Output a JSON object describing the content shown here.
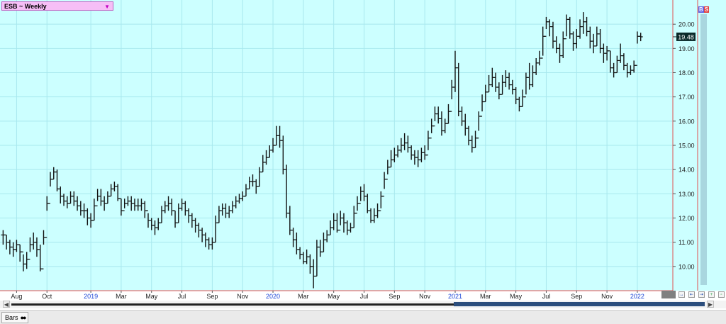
{
  "header": {
    "symbol_label": "ESB ~ Weekly",
    "dropdown_icon": "triangle-down-icon",
    "badge_b": "B",
    "badge_s": "S"
  },
  "colors": {
    "plot_bg": "#ccffff",
    "grid": "#a8e8ee",
    "bars": "#111111",
    "axis_line": "#e05050",
    "date_year": "#1a45d6",
    "price_tag_bg": "#0a2a2a"
  },
  "footer": {
    "tab_label": "Bars",
    "scroll_left_icon": "arrow-left-icon",
    "scroll_right_icon": "arrow-right-icon"
  },
  "chart_data": {
    "type": "bar",
    "subtype": "ohlc",
    "series_name": "ESB",
    "interval": "Weekly",
    "last_price_label": "19.48",
    "ylim": [
      9.0,
      21.0
    ],
    "y_ticks": [
      "10.00",
      "11.00",
      "12.00",
      "13.00",
      "14.00",
      "15.00",
      "16.00",
      "17.00",
      "18.00",
      "19.00",
      "20.00"
    ],
    "x_ticks": [
      {
        "label": "Aug",
        "t": 4,
        "year": false
      },
      {
        "label": "Oct",
        "t": 13,
        "year": false
      },
      {
        "label": "2019",
        "t": 26,
        "year": true
      },
      {
        "label": "Mar",
        "t": 35,
        "year": false
      },
      {
        "label": "May",
        "t": 44,
        "year": false
      },
      {
        "label": "Jul",
        "t": 53,
        "year": false
      },
      {
        "label": "Sep",
        "t": 62,
        "year": false
      },
      {
        "label": "Nov",
        "t": 71,
        "year": false
      },
      {
        "label": "2020",
        "t": 80,
        "year": true
      },
      {
        "label": "Mar",
        "t": 89,
        "year": false
      },
      {
        "label": "May",
        "t": 98,
        "year": false
      },
      {
        "label": "Jul",
        "t": 107,
        "year": false
      },
      {
        "label": "Sep",
        "t": 116,
        "year": false
      },
      {
        "label": "Nov",
        "t": 125,
        "year": false
      },
      {
        "label": "2021",
        "t": 134,
        "year": true
      },
      {
        "label": "Mar",
        "t": 143,
        "year": false
      },
      {
        "label": "May",
        "t": 152,
        "year": false
      },
      {
        "label": "Jul",
        "t": 161,
        "year": false
      },
      {
        "label": "Sep",
        "t": 170,
        "year": false
      },
      {
        "label": "Nov",
        "t": 179,
        "year": false
      },
      {
        "label": "2022",
        "t": 188,
        "year": true
      }
    ],
    "x_range": [
      -0.5,
      196
    ],
    "close": [
      11.3,
      11.0,
      10.8,
      10.7,
      10.9,
      10.6,
      10.1,
      10.3,
      10.9,
      11.0,
      10.7,
      9.9,
      11.2,
      12.6,
      13.6,
      13.9,
      13.2,
      12.9,
      12.7,
      12.6,
      12.9,
      12.7,
      12.5,
      12.3,
      12.3,
      12.0,
      11.9,
      12.5,
      12.9,
      12.7,
      12.6,
      12.9,
      13.2,
      13.3,
      12.8,
      12.3,
      12.6,
      12.7,
      12.6,
      12.5,
      12.5,
      12.6,
      12.3,
      11.9,
      11.7,
      11.6,
      11.8,
      12.3,
      12.5,
      12.6,
      12.3,
      11.8,
      12.4,
      12.6,
      12.3,
      12.1,
      11.9,
      11.7,
      11.5,
      11.3,
      11.1,
      10.9,
      11.0,
      11.8,
      12.3,
      12.4,
      12.2,
      12.3,
      12.5,
      12.7,
      12.8,
      12.9,
      13.2,
      13.5,
      13.5,
      13.3,
      13.9,
      14.3,
      14.5,
      14.8,
      15.0,
      15.4,
      15.2,
      14.0,
      12.2,
      11.5,
      11.1,
      10.7,
      10.5,
      10.2,
      10.4,
      10.0,
      9.6,
      10.8,
      10.6,
      11.1,
      11.3,
      11.6,
      11.9,
      11.5,
      12.0,
      11.8,
      11.5,
      11.6,
      12.2,
      12.6,
      13.1,
      12.9,
      12.3,
      11.9,
      12.1,
      12.3,
      12.9,
      13.6,
      14.1,
      14.4,
      14.6,
      14.8,
      15.0,
      15.1,
      14.9,
      14.6,
      14.5,
      14.4,
      14.7,
      14.6,
      15.3,
      15.8,
      16.3,
      16.1,
      15.6,
      15.9,
      16.4,
      17.4,
      18.2,
      16.4,
      16.0,
      15.7,
      15.2,
      14.9,
      15.3,
      16.2,
      16.8,
      17.2,
      17.5,
      17.8,
      17.4,
      17.1,
      17.6,
      17.8,
      17.5,
      17.3,
      16.9,
      16.6,
      17.0,
      17.8,
      17.5,
      18.0,
      18.4,
      18.6,
      19.5,
      20.1,
      19.9,
      19.3,
      19.0,
      18.7,
      19.4,
      20.2,
      19.6,
      19.2,
      19.5,
      19.9,
      20.1,
      19.7,
      19.3,
      19.1,
      19.6,
      19.0,
      18.8,
      18.9,
      18.2,
      18.0,
      18.5,
      18.7,
      18.3,
      18.0,
      18.1,
      18.3,
      19.5,
      19.48
    ],
    "high": [
      11.5,
      11.3,
      11.1,
      11.0,
      11.1,
      10.9,
      10.5,
      10.6,
      11.2,
      11.4,
      11.2,
      10.9,
      11.5,
      12.9,
      13.9,
      14.1,
      14.0,
      13.3,
      13.0,
      12.9,
      13.1,
      13.1,
      12.9,
      12.7,
      12.6,
      12.4,
      12.2,
      12.8,
      13.2,
      13.2,
      12.9,
      13.1,
      13.4,
      13.5,
      13.4,
      12.8,
      12.8,
      12.9,
      12.9,
      12.8,
      12.8,
      12.8,
      12.7,
      12.2,
      12.0,
      11.9,
      12.0,
      12.5,
      12.7,
      12.9,
      12.8,
      12.3,
      12.6,
      12.8,
      12.7,
      12.4,
      12.2,
      12.0,
      11.8,
      11.6,
      11.4,
      11.2,
      11.2,
      12.1,
      12.5,
      12.6,
      12.6,
      12.5,
      12.7,
      12.9,
      13.0,
      13.1,
      13.4,
      13.7,
      13.8,
      13.6,
      14.1,
      14.6,
      14.8,
      15.0,
      15.3,
      15.8,
      15.8,
      15.4,
      14.2,
      12.5,
      11.6,
      11.4,
      10.8,
      10.6,
      10.7,
      10.5,
      10.3,
      11.1,
      11.1,
      11.4,
      11.5,
      11.9,
      12.2,
      12.2,
      12.3,
      12.2,
      11.9,
      11.8,
      12.5,
      12.9,
      13.3,
      13.4,
      13.0,
      12.4,
      12.4,
      12.6,
      13.1,
      13.9,
      14.4,
      14.8,
      14.9,
      15.0,
      15.3,
      15.5,
      15.4,
      15.0,
      14.8,
      14.8,
      14.9,
      15.0,
      15.6,
      16.1,
      16.6,
      16.6,
      16.4,
      16.1,
      16.7,
      17.7,
      18.9,
      18.4,
      16.6,
      16.3,
      15.8,
      15.4,
      15.6,
      16.4,
      17.1,
      17.5,
      17.9,
      18.2,
      18.0,
      17.6,
      17.9,
      18.1,
      18.0,
      17.7,
      17.4,
      17.0,
      17.3,
      18.0,
      18.4,
      18.3,
      18.6,
      18.9,
      19.9,
      20.3,
      20.2,
      20.1,
      19.5,
      19.2,
      19.7,
      20.4,
      20.3,
      19.7,
      19.8,
      20.2,
      20.5,
      20.3,
      19.9,
      19.6,
      19.9,
      19.8,
      19.2,
      19.1,
      18.9,
      18.4,
      18.7,
      19.2,
      18.8,
      18.4,
      18.3,
      18.5,
      19.7,
      19.65
    ],
    "low": [
      10.9,
      10.7,
      10.5,
      10.4,
      10.6,
      10.2,
      9.8,
      9.9,
      10.6,
      10.7,
      10.4,
      9.8,
      10.9,
      12.3,
      13.3,
      13.6,
      13.1,
      12.6,
      12.5,
      12.4,
      12.6,
      12.5,
      12.3,
      12.1,
      12.0,
      11.7,
      11.6,
      11.9,
      12.7,
      12.5,
      12.3,
      12.6,
      12.9,
      13.1,
      12.7,
      12.1,
      12.4,
      12.5,
      12.3,
      12.3,
      12.3,
      12.3,
      12.0,
      11.6,
      11.5,
      11.3,
      11.5,
      11.8,
      12.2,
      12.3,
      12.1,
      11.6,
      11.8,
      12.3,
      12.1,
      11.8,
      11.6,
      11.4,
      11.2,
      11.0,
      10.8,
      10.7,
      10.7,
      11.0,
      11.8,
      12.1,
      12.0,
      12.0,
      12.2,
      12.4,
      12.6,
      12.7,
      12.9,
      13.2,
      13.3,
      13.0,
      13.3,
      13.9,
      14.2,
      14.5,
      14.7,
      15.0,
      14.9,
      13.8,
      12.0,
      11.3,
      10.8,
      10.5,
      10.3,
      10.1,
      10.1,
      9.7,
      9.1,
      9.6,
      10.4,
      10.6,
      11.0,
      11.3,
      11.5,
      11.4,
      11.7,
      11.4,
      11.3,
      11.4,
      11.6,
      12.3,
      12.7,
      12.7,
      12.2,
      11.8,
      11.8,
      12.0,
      12.4,
      13.2,
      13.8,
      14.1,
      14.3,
      14.5,
      14.7,
      14.8,
      14.7,
      14.4,
      14.2,
      14.1,
      14.3,
      14.4,
      14.8,
      15.5,
      16.0,
      15.9,
      15.4,
      15.5,
      15.9,
      16.9,
      17.2,
      16.2,
      15.8,
      15.4,
      15.0,
      14.7,
      14.9,
      15.6,
      16.4,
      16.8,
      17.2,
      17.4,
      17.2,
      16.9,
      17.1,
      17.4,
      17.3,
      17.1,
      16.7,
      16.4,
      16.6,
      17.1,
      17.3,
      17.4,
      17.9,
      18.3,
      18.7,
      19.8,
      19.5,
      19.0,
      18.8,
      18.4,
      18.6,
      19.5,
      19.4,
      18.9,
      19.0,
      19.4,
      19.6,
      19.5,
      19.0,
      18.8,
      19.1,
      18.8,
      18.4,
      18.5,
      18.0,
      17.8,
      18.0,
      18.4,
      18.1,
      17.8,
      17.9,
      18.0,
      19.2,
      19.3
    ]
  }
}
